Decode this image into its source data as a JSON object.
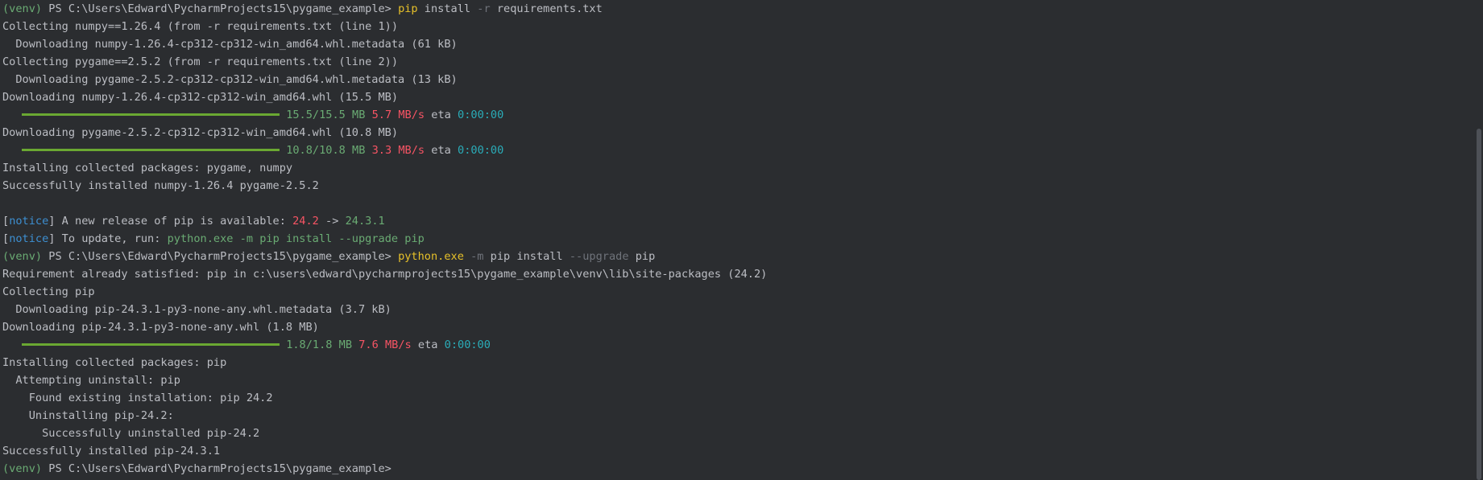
{
  "colors": {
    "background": "#2b2d30",
    "text": "#bcbec4",
    "green": "#6aab73",
    "red": "#f75464",
    "cyan": "#2aacb8",
    "yellow": "#e6c029",
    "gray": "#6f737a",
    "blue": "#3d8fd1",
    "bar": "#6aa832"
  },
  "terminal": {
    "prompt_venv": "(venv)",
    "prompt_path": " PS C:\\Users\\Edward\\PycharmProjects15\\pygame_example> ",
    "cmd1": {
      "prog": "pip",
      "a1": " install ",
      "flag": "-r",
      "a2": " requirements.txt"
    },
    "l2": "Collecting numpy==1.26.4 (from -r requirements.txt (line 1))",
    "l3": "  Downloading numpy-1.26.4-cp312-cp312-win_amd64.whl.metadata (61 kB)",
    "l4": "Collecting pygame==2.5.2 (from -r requirements.txt (line 2))",
    "l5": "  Downloading pygame-2.5.2-cp312-cp312-win_amd64.whl.metadata (13 kB)",
    "l6": "Downloading numpy-1.26.4-cp312-cp312-win_amd64.whl (15.5 MB)",
    "prog1": {
      "size": "15.5/15.5 MB",
      "speed": "5.7 MB/s",
      "eta_label": "eta",
      "eta": "0:00:00",
      "fraction": 1.0
    },
    "l8": "Downloading pygame-2.5.2-cp312-cp312-win_amd64.whl (10.8 MB)",
    "prog2": {
      "size": "10.8/10.8 MB",
      "speed": "3.3 MB/s",
      "eta_label": "eta",
      "eta": "0:00:00",
      "fraction": 1.0
    },
    "l10": "Installing collected packages: pygame, numpy",
    "l11": "Successfully installed numpy-1.26.4 pygame-2.5.2",
    "notice1": {
      "lb": "[",
      "word": "notice",
      "rb": "]",
      "text": " A new release of pip is available: ",
      "old": "24.2",
      "arrow": " -> ",
      "new": "24.3.1"
    },
    "notice2": {
      "lb": "[",
      "word": "notice",
      "rb": "]",
      "text": " To update, run: ",
      "cmd": "python.exe -m pip install --upgrade pip"
    },
    "cmd2": {
      "prog": "python.exe",
      "sp1": " ",
      "flag1": "-m",
      "a1": " pip install ",
      "flag2": "--upgrade",
      "a2": " pip"
    },
    "l16": "Requirement already satisfied: pip in c:\\users\\edward\\pycharmprojects15\\pygame_example\\venv\\lib\\site-packages (24.2)",
    "l17": "Collecting pip",
    "l18": "  Downloading pip-24.3.1-py3-none-any.whl.metadata (3.7 kB)",
    "l19": "Downloading pip-24.3.1-py3-none-any.whl (1.8 MB)",
    "prog3": {
      "size": "1.8/1.8 MB",
      "speed": "7.6 MB/s",
      "eta_label": "eta",
      "eta": "0:00:00",
      "fraction": 1.0
    },
    "l21": "Installing collected packages: pip",
    "l22": "  Attempting uninstall: pip",
    "l23": "    Found existing installation: pip 24.2",
    "l24": "    Uninstalling pip-24.2:",
    "l25": "      Successfully uninstalled pip-24.2",
    "l26": "Successfully installed pip-24.3.1"
  }
}
